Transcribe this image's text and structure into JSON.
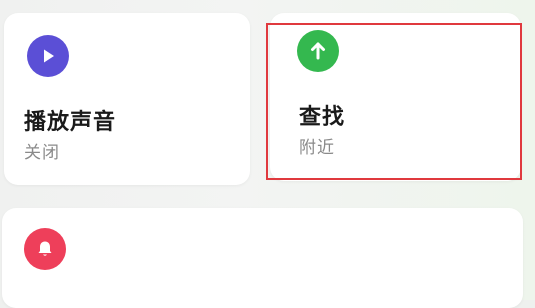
{
  "cards": {
    "play_sound": {
      "title": "播放声音",
      "status": "关闭",
      "icon": "play-icon",
      "icon_color": "#5b4fd6"
    },
    "find": {
      "title": "查找",
      "status": "附近",
      "icon": "arrow-up-icon",
      "icon_color": "#34b84f"
    },
    "notify": {
      "icon": "bell-icon",
      "icon_color": "#ee3f5a"
    }
  },
  "highlight": {
    "color": "#e0393e",
    "target": "find"
  }
}
